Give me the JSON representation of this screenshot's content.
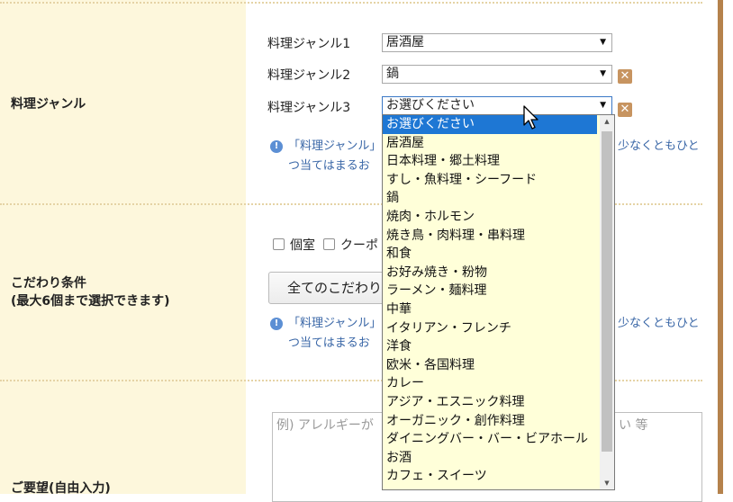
{
  "genre": {
    "section_label": "料理ジャンル",
    "rows": [
      {
        "label": "料理ジャンル1",
        "value": "居酒屋"
      },
      {
        "label": "料理ジャンル2",
        "value": "鍋"
      },
      {
        "label": "料理ジャンル3",
        "value": "お選びください"
      }
    ],
    "note_line1_left": "「料理ジャンル」",
    "note_line1_right": "少なくともひと",
    "note_line2": "つ当てはまるお"
  },
  "kodawari": {
    "section_label_line1": "こだわり条件",
    "section_label_line2": "(最大6個まで選択できます)",
    "checkbox_labels": [
      "個室",
      "クーポ"
    ],
    "button_label": "全てのこだわり",
    "note_line1_left": "「料理ジャンル」",
    "note_line1_right": "少なくともひと",
    "note_line2": "つ当てはまるお"
  },
  "request": {
    "section_label": "ご要望(自由入力)",
    "placeholder_left": "例) アレルギーが",
    "placeholder_right": "い 等"
  },
  "dropdown": {
    "selected_index": 0,
    "options": [
      "お選びください",
      "居酒屋",
      "日本料理・郷土料理",
      "すし・魚料理・シーフード",
      "鍋",
      "焼肉・ホルモン",
      "焼き鳥・肉料理・串料理",
      "和食",
      "お好み焼き・粉物",
      "ラーメン・麺料理",
      "中華",
      "イタリアン・フレンチ",
      "洋食",
      "欧米・各国料理",
      "カレー",
      "アジア・エスニック料理",
      "オーガニック・創作料理",
      "ダイニングバー・バー・ビアホール",
      "お酒",
      "カフェ・スイーツ"
    ]
  },
  "icons": {
    "arrow": "▼",
    "remove": "✕",
    "info": "!",
    "scroll_up": "▲",
    "scroll_down": "▼"
  },
  "colors": {
    "label_bg": "#fdf7dc",
    "accent_border": "#b5824c",
    "remove_button": "#c79460",
    "note_text": "#3a67a7",
    "dropdown_bg": "#ffffd9",
    "dropdown_selected": "#1e77d4"
  }
}
